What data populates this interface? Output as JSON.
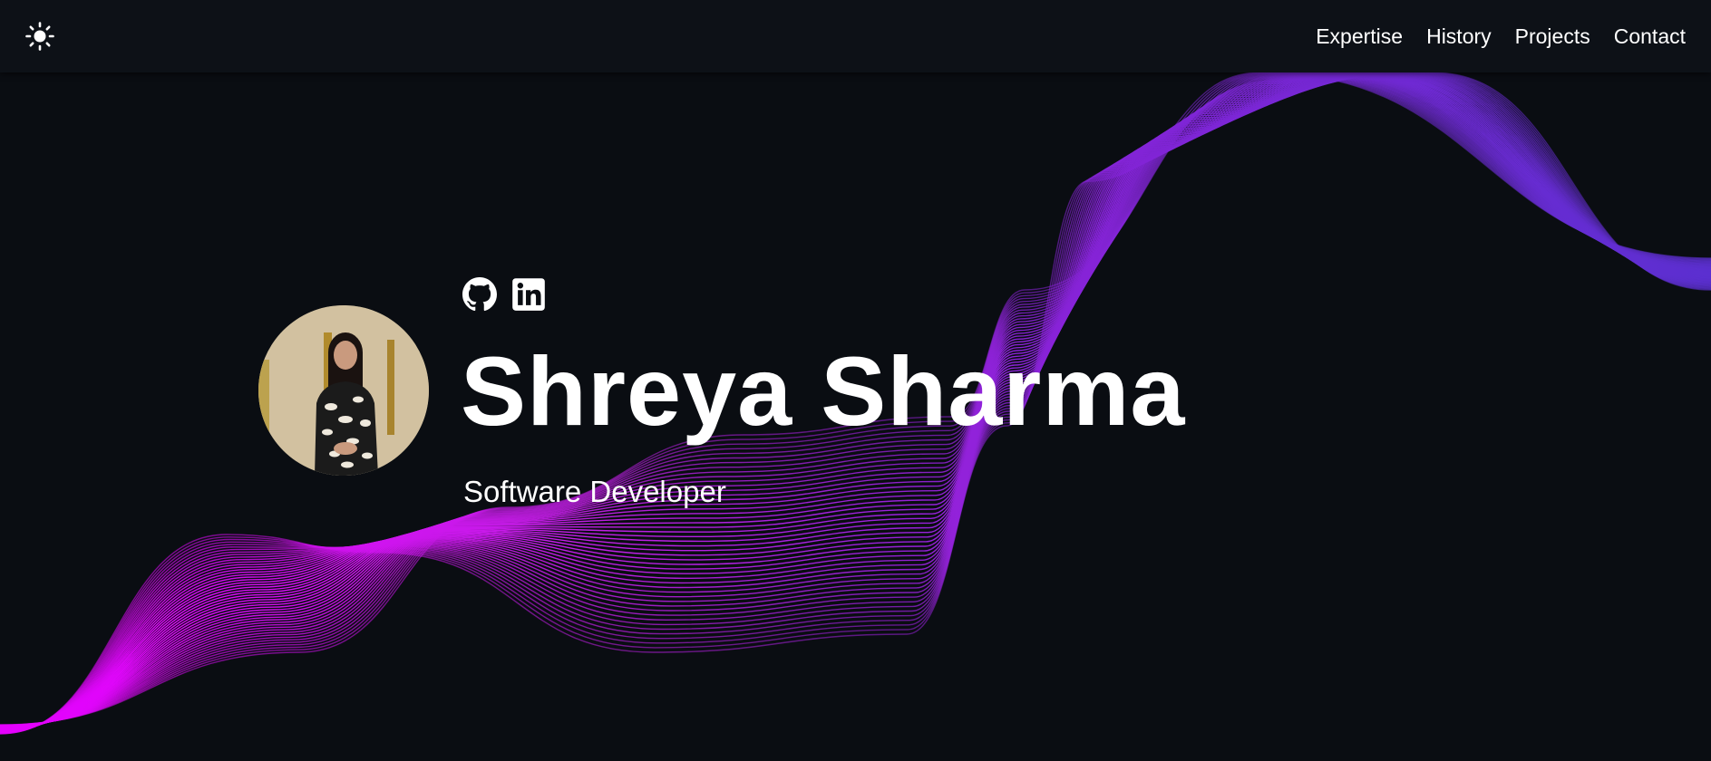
{
  "nav": {
    "theme_icon": "sun-icon",
    "links": [
      "Expertise",
      "History",
      "Projects",
      "Contact"
    ]
  },
  "hero": {
    "name": "Shreya Sharma",
    "role": "Software Developer",
    "avatar_icon": "profile-photo",
    "socials": [
      {
        "icon": "github-icon"
      },
      {
        "icon": "linkedin-icon"
      }
    ]
  },
  "colors": {
    "background": "#0a0d12",
    "navbar": "#0d1117",
    "text": "#ffffff",
    "wave_magenta": "#e600ff",
    "wave_purple": "#8a22d8",
    "wave_indigo": "#5b2fd0"
  }
}
